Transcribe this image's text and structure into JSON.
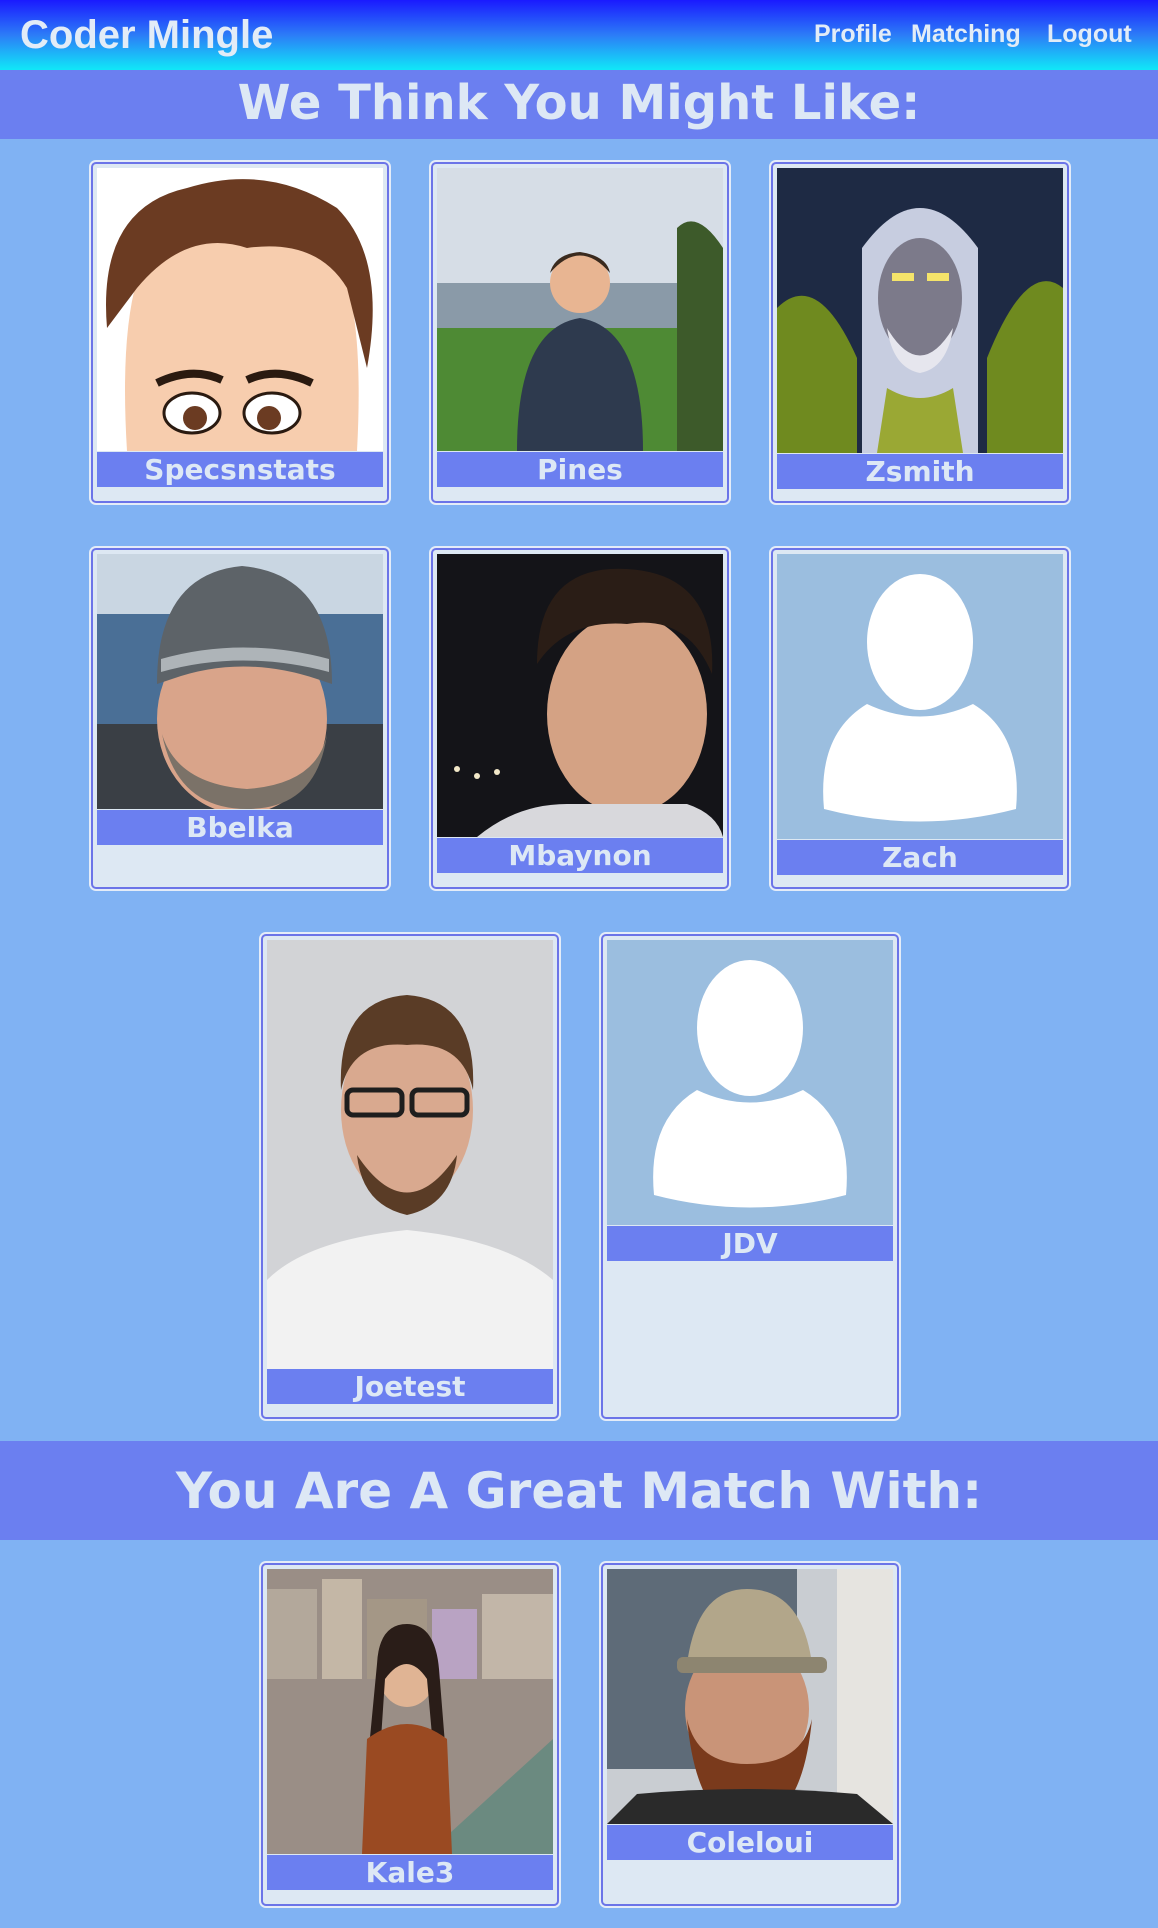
{
  "app": {
    "title": "Coder Mingle"
  },
  "nav": {
    "profile": "Profile",
    "matching": "Matching",
    "logout": "Logout"
  },
  "suggestions": {
    "heading": "We Think You Might Like:",
    "users": [
      {
        "name": "Specsnstats",
        "avatar": "cartoon-avatar-icon"
      },
      {
        "name": "Pines",
        "avatar": "user-photo-icon"
      },
      {
        "name": "Zsmith",
        "avatar": "fantasy-character-icon"
      },
      {
        "name": "Bbelka",
        "avatar": "user-photo-icon"
      },
      {
        "name": "Mbaynon",
        "avatar": "user-photo-icon"
      },
      {
        "name": "Zach",
        "avatar": "default-avatar-icon"
      },
      {
        "name": "Joetest",
        "avatar": "user-photo-icon"
      },
      {
        "name": "JDV",
        "avatar": "default-avatar-icon"
      }
    ]
  },
  "matches": {
    "heading": "You Are A Great Match With:",
    "users": [
      {
        "name": "Kale3",
        "avatar": "user-photo-icon"
      },
      {
        "name": "Coleloui",
        "avatar": "user-photo-icon"
      }
    ]
  }
}
